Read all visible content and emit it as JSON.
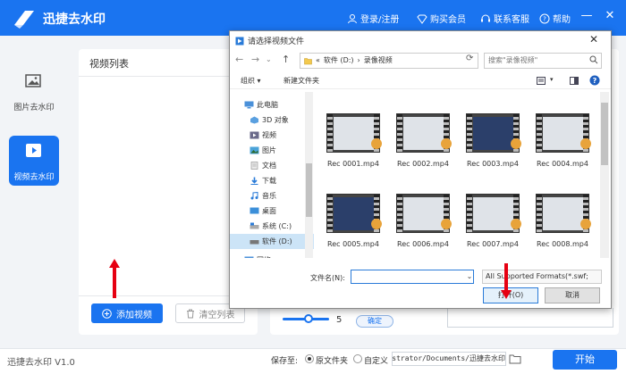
{
  "app": {
    "title": "迅捷去水印",
    "nav_top": [
      "登录/注册",
      "购买会员",
      "联系客服",
      "帮助"
    ],
    "accent": "#1a74f0"
  },
  "sidebar": {
    "items": [
      {
        "label": "图片去水印",
        "icon": "image-icon",
        "active": false
      },
      {
        "label": "视频去水印",
        "icon": "video-play-icon",
        "active": true
      }
    ]
  },
  "video_list": {
    "header": "视频列表",
    "add_label": "添加视频",
    "clear_label": "清空列表"
  },
  "right_panel": {
    "slider_value": "5",
    "confirm_label": "确定"
  },
  "bottom": {
    "version": "迅捷去水印 V1.0",
    "save_to_label": "保存至:",
    "option_original": "原文件夹",
    "option_custom": "自定义",
    "path": "istrator/Documents/迅捷去水印",
    "start_label": "开始"
  },
  "dialog": {
    "title": "请选择视频文件",
    "close": "✕",
    "breadcrumb": [
      "«",
      "软件 (D:)",
      "›",
      "录像视频"
    ],
    "search_placeholder": "搜索\"录像视频\"",
    "organize_label": "组织 ▾",
    "new_folder_label": "新建文件夹",
    "tree": [
      "此电脑",
      "3D 对象",
      "视频",
      "图片",
      "文档",
      "下载",
      "音乐",
      "桌面",
      "系统 (C:)",
      "软件 (D:)",
      "网络"
    ],
    "files": [
      "Rec 0001.mp4",
      "Rec 0002.mp4",
      "Rec 0003.mp4",
      "Rec 0004.mp4",
      "Rec 0005.mp4",
      "Rec 0006.mp4",
      "Rec 0007.mp4",
      "Rec 0008.mp4"
    ],
    "filename_label": "文件名(N):",
    "filetype": "All Supported Formats(*.swf;",
    "open_label": "打开(O)",
    "cancel_label": "取消"
  }
}
